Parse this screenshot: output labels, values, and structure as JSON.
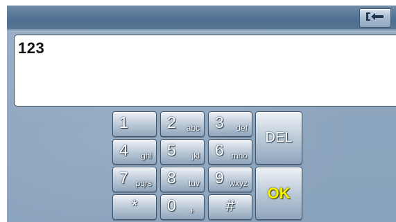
{
  "header": {
    "back_icon": "back-arrow-icon"
  },
  "entry": {
    "value": "123"
  },
  "keypad": {
    "keys": [
      {
        "num": "1",
        "sub": ""
      },
      {
        "num": "2",
        "sub": "abc"
      },
      {
        "num": "3",
        "sub": "def"
      },
      {
        "num": "4",
        "sub": "ghi"
      },
      {
        "num": "5",
        "sub": "jkl"
      },
      {
        "num": "6",
        "sub": "mno"
      },
      {
        "num": "7",
        "sub": "pqrs"
      },
      {
        "num": "8",
        "sub": "tuv"
      },
      {
        "num": "9",
        "sub": "wxyz"
      },
      {
        "num": "*",
        "sub": ""
      },
      {
        "num": "0",
        "sub": "+"
      },
      {
        "num": "#",
        "sub": ""
      }
    ],
    "del_label": "DEL",
    "ok_label": "OK",
    "ok_color": "#f4f000"
  }
}
